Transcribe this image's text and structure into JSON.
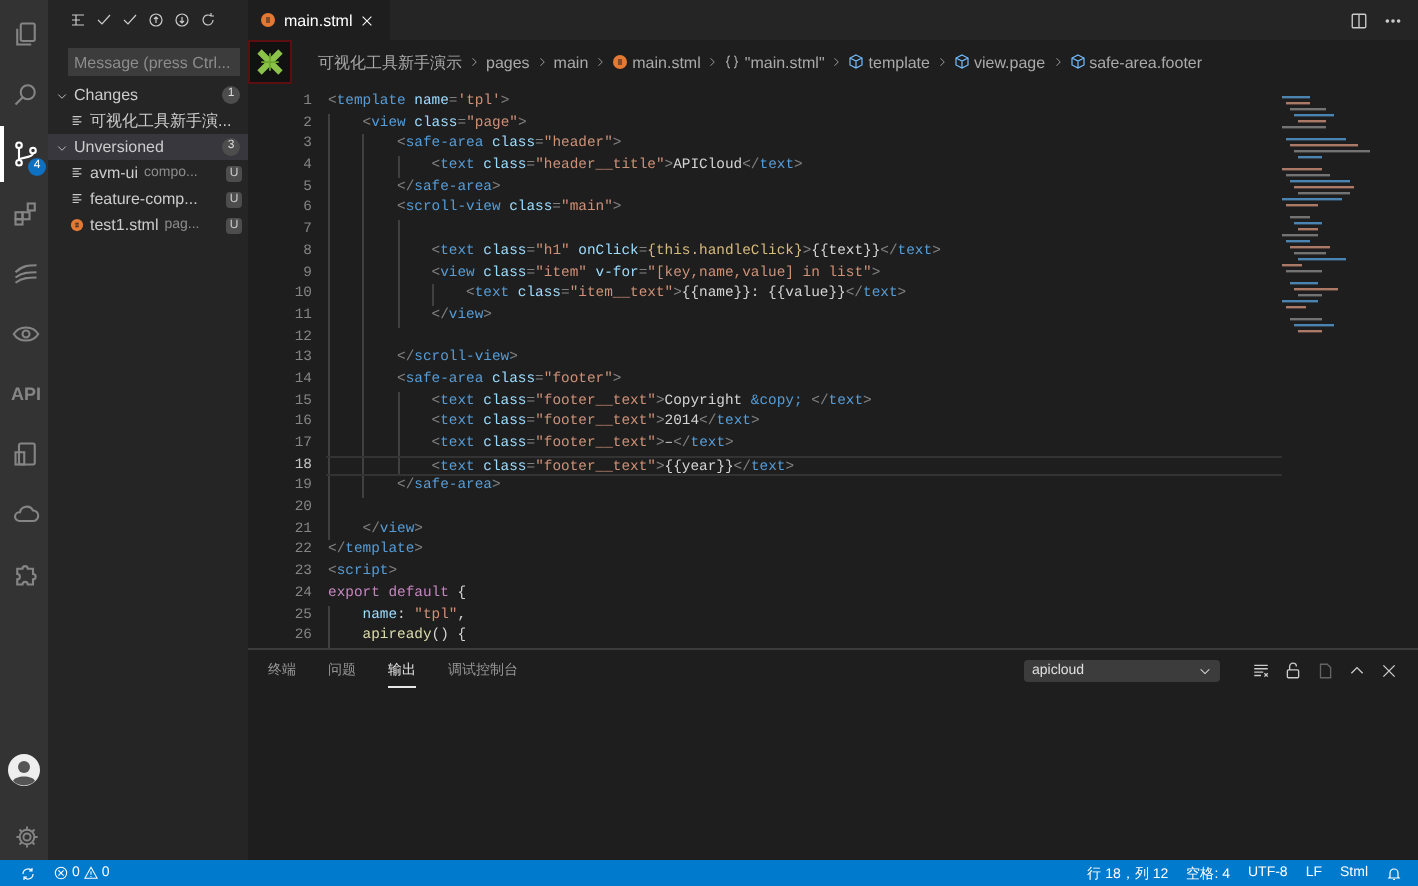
{
  "activity_bar": [
    {
      "kind": "files",
      "selected": false
    },
    {
      "kind": "search",
      "selected": false
    },
    {
      "kind": "scm",
      "selected": true,
      "badge": "4"
    },
    {
      "kind": "extensions",
      "selected": false
    },
    {
      "kind": "swirl",
      "selected": false
    },
    {
      "kind": "eye",
      "selected": false
    },
    {
      "kind": "api",
      "label": "API",
      "selected": false
    },
    {
      "kind": "phone",
      "selected": false
    },
    {
      "kind": "cloud",
      "selected": false
    },
    {
      "kind": "puzzle",
      "selected": false
    }
  ],
  "sidebar": {
    "message_field": {
      "placeholder": "Message (press Ctrl..."
    },
    "groups": [
      {
        "label": "Changes",
        "count": "1",
        "expanded": true,
        "items": [
          {
            "kind": "file",
            "name": "可视化工具新手演...",
            "selected": false
          }
        ]
      },
      {
        "label": "Unversioned",
        "count": "3",
        "expanded": true,
        "items": [
          {
            "kind": "file",
            "name": "avm-ui",
            "detail": "compo...",
            "badge": "U",
            "selected": false
          },
          {
            "kind": "file",
            "name": "feature-comp...",
            "badge": "U",
            "selected": false
          },
          {
            "kind": "stml",
            "name": "test1.stml",
            "detail": "pag...",
            "badge": "U",
            "selected": false
          }
        ]
      }
    ]
  },
  "tabs": [
    {
      "label": "main.stml",
      "selected": true
    }
  ],
  "breadcrumbs": [
    {
      "kind": "folder",
      "label": "可视化工具新手演示"
    },
    {
      "kind": "folder",
      "label": "pages"
    },
    {
      "kind": "folder",
      "label": "main"
    },
    {
      "kind": "stml",
      "label": "main.stml"
    },
    {
      "kind": "module",
      "label": "\"main.stml\""
    },
    {
      "kind": "element",
      "label": "template"
    },
    {
      "kind": "element",
      "label": "view.page"
    },
    {
      "kind": "element",
      "label": "safe-area.footer"
    }
  ],
  "code": [
    {
      "number": "1",
      "current": false,
      "tokens": [
        {
          "kind": "punct",
          "text": "<"
        },
        {
          "kind": "tag",
          "text": "template"
        },
        {
          "kind": "attr",
          "text": " name"
        },
        {
          "kind": "punct",
          "text": "="
        },
        {
          "kind": "string",
          "text": "'tpl'"
        },
        {
          "kind": "punct",
          "text": ">"
        }
      ]
    },
    {
      "number": "2",
      "current": false,
      "tokens": [
        {
          "kind": "punct",
          "text": "    <"
        },
        {
          "kind": "tag",
          "text": "view"
        },
        {
          "kind": "attr",
          "text": " class"
        },
        {
          "kind": "punct",
          "text": "="
        },
        {
          "kind": "string",
          "text": "\"page\""
        },
        {
          "kind": "punct",
          "text": ">"
        }
      ]
    },
    {
      "number": "3",
      "current": false,
      "tokens": [
        {
          "kind": "punct",
          "text": "        <"
        },
        {
          "kind": "tag",
          "text": "safe-area"
        },
        {
          "kind": "attr",
          "text": " class"
        },
        {
          "kind": "punct",
          "text": "="
        },
        {
          "kind": "string",
          "text": "\"header\""
        },
        {
          "kind": "punct",
          "text": ">"
        }
      ]
    },
    {
      "number": "4",
      "current": false,
      "tokens": [
        {
          "kind": "punct",
          "text": "            <"
        },
        {
          "kind": "tag",
          "text": "text"
        },
        {
          "kind": "attr",
          "text": " class"
        },
        {
          "kind": "punct",
          "text": "="
        },
        {
          "kind": "string",
          "text": "\"header__title\""
        },
        {
          "kind": "punct",
          "text": ">"
        },
        {
          "kind": "text",
          "text": "APICloud"
        },
        {
          "kind": "punct",
          "text": "</"
        },
        {
          "kind": "tag",
          "text": "text"
        },
        {
          "kind": "punct",
          "text": ">"
        }
      ]
    },
    {
      "number": "5",
      "current": false,
      "tokens": [
        {
          "kind": "punct",
          "text": "        </"
        },
        {
          "kind": "tag",
          "text": "safe-area"
        },
        {
          "kind": "punct",
          "text": ">"
        }
      ]
    },
    {
      "number": "6",
      "current": false,
      "tokens": [
        {
          "kind": "punct",
          "text": "        <"
        },
        {
          "kind": "tag",
          "text": "scroll-view"
        },
        {
          "kind": "attr",
          "text": " class"
        },
        {
          "kind": "punct",
          "text": "="
        },
        {
          "kind": "string",
          "text": "\"main\""
        },
        {
          "kind": "punct",
          "text": ">"
        }
      ]
    },
    {
      "number": "7",
      "current": false
    },
    {
      "number": "8",
      "current": false,
      "tokens": [
        {
          "kind": "punct",
          "text": "            <"
        },
        {
          "kind": "tag",
          "text": "text"
        },
        {
          "kind": "attr",
          "text": " class"
        },
        {
          "kind": "punct",
          "text": "="
        },
        {
          "kind": "string",
          "text": "\"h1\""
        },
        {
          "kind": "attr",
          "text": " onClick"
        },
        {
          "kind": "punct",
          "text": "="
        },
        {
          "kind": "expr",
          "text": "{this.handleClick}"
        },
        {
          "kind": "punct",
          "text": ">"
        },
        {
          "kind": "text",
          "text": "{{text}}"
        },
        {
          "kind": "punct",
          "text": "</"
        },
        {
          "kind": "tag",
          "text": "text"
        },
        {
          "kind": "punct",
          "text": ">"
        }
      ]
    },
    {
      "number": "9",
      "current": false,
      "tokens": [
        {
          "kind": "punct",
          "text": "            <"
        },
        {
          "kind": "tag",
          "text": "view"
        },
        {
          "kind": "attr",
          "text": " class"
        },
        {
          "kind": "punct",
          "text": "="
        },
        {
          "kind": "string",
          "text": "\"item\""
        },
        {
          "kind": "attr",
          "text": " v-for"
        },
        {
          "kind": "punct",
          "text": "="
        },
        {
          "kind": "string",
          "text": "\"[key,name,value] in list\""
        },
        {
          "kind": "punct",
          "text": ">"
        }
      ]
    },
    {
      "number": "10",
      "current": false,
      "tokens": [
        {
          "kind": "punct",
          "text": "                <"
        },
        {
          "kind": "tag",
          "text": "text"
        },
        {
          "kind": "attr",
          "text": " class"
        },
        {
          "kind": "punct",
          "text": "="
        },
        {
          "kind": "string",
          "text": "\"item__text\""
        },
        {
          "kind": "punct",
          "text": ">"
        },
        {
          "kind": "text",
          "text": "{{name}}: {{value}}"
        },
        {
          "kind": "punct",
          "text": "</"
        },
        {
          "kind": "tag",
          "text": "text"
        },
        {
          "kind": "punct",
          "text": ">"
        }
      ]
    },
    {
      "number": "11",
      "current": false,
      "tokens": [
        {
          "kind": "punct",
          "text": "            </"
        },
        {
          "kind": "tag",
          "text": "view"
        },
        {
          "kind": "punct",
          "text": ">"
        }
      ]
    },
    {
      "number": "12",
      "current": false
    },
    {
      "number": "13",
      "current": false,
      "tokens": [
        {
          "kind": "punct",
          "text": "        </"
        },
        {
          "kind": "tag",
          "text": "scroll-view"
        },
        {
          "kind": "punct",
          "text": ">"
        }
      ]
    },
    {
      "number": "14",
      "current": false,
      "tokens": [
        {
          "kind": "punct",
          "text": "        <"
        },
        {
          "kind": "tag",
          "text": "safe-area"
        },
        {
          "kind": "attr",
          "text": " class"
        },
        {
          "kind": "punct",
          "text": "="
        },
        {
          "kind": "string",
          "text": "\"footer\""
        },
        {
          "kind": "punct",
          "text": ">"
        }
      ]
    },
    {
      "number": "15",
      "current": false,
      "tokens": [
        {
          "kind": "punct",
          "text": "            <"
        },
        {
          "kind": "tag",
          "text": "text"
        },
        {
          "kind": "attr",
          "text": " class"
        },
        {
          "kind": "punct",
          "text": "="
        },
        {
          "kind": "string",
          "text": "\"footer__text\""
        },
        {
          "kind": "punct",
          "text": ">"
        },
        {
          "kind": "text",
          "text": "Copyright "
        },
        {
          "kind": "tag",
          "text": "&copy;"
        },
        {
          "kind": "punct",
          "text": " </"
        },
        {
          "kind": "tag",
          "text": "text"
        },
        {
          "kind": "punct",
          "text": ">"
        }
      ]
    },
    {
      "number": "16",
      "current": false,
      "tokens": [
        {
          "kind": "punct",
          "text": "            <"
        },
        {
          "kind": "tag",
          "text": "text"
        },
        {
          "kind": "attr",
          "text": " class"
        },
        {
          "kind": "punct",
          "text": "="
        },
        {
          "kind": "string",
          "text": "\"footer__text\""
        },
        {
          "kind": "punct",
          "text": ">"
        },
        {
          "kind": "text",
          "text": "2014"
        },
        {
          "kind": "punct",
          "text": "</"
        },
        {
          "kind": "tag",
          "text": "text"
        },
        {
          "kind": "punct",
          "text": ">"
        }
      ]
    },
    {
      "number": "17",
      "current": false,
      "tokens": [
        {
          "kind": "punct",
          "text": "            <"
        },
        {
          "kind": "tag",
          "text": "text"
        },
        {
          "kind": "attr",
          "text": " class"
        },
        {
          "kind": "punct",
          "text": "="
        },
        {
          "kind": "string",
          "text": "\"footer__text\""
        },
        {
          "kind": "punct",
          "text": ">"
        },
        {
          "kind": "text",
          "text": "–"
        },
        {
          "kind": "punct",
          "text": "</"
        },
        {
          "kind": "tag",
          "text": "text"
        },
        {
          "kind": "punct",
          "text": ">"
        }
      ]
    },
    {
      "number": "18",
      "current": true,
      "tokens": [
        {
          "kind": "punct",
          "text": "            <"
        },
        {
          "kind": "tag",
          "text": "text"
        },
        {
          "kind": "attr",
          "text": " class"
        },
        {
          "kind": "punct",
          "text": "="
        },
        {
          "kind": "string",
          "text": "\"footer__text\""
        },
        {
          "kind": "punct",
          "text": ">"
        },
        {
          "kind": "text",
          "text": "{{year}}"
        },
        {
          "kind": "punct",
          "text": "</"
        },
        {
          "kind": "tag",
          "text": "text"
        },
        {
          "kind": "punct",
          "text": ">"
        }
      ]
    },
    {
      "number": "19",
      "current": false,
      "tokens": [
        {
          "kind": "punct",
          "text": "        </"
        },
        {
          "kind": "tag",
          "text": "safe-area"
        },
        {
          "kind": "punct",
          "text": ">"
        }
      ]
    },
    {
      "number": "20",
      "current": false
    },
    {
      "number": "21",
      "current": false,
      "tokens": [
        {
          "kind": "punct",
          "text": "    </"
        },
        {
          "kind": "tag",
          "text": "view"
        },
        {
          "kind": "punct",
          "text": ">"
        }
      ]
    },
    {
      "number": "22",
      "current": false,
      "tokens": [
        {
          "kind": "punct",
          "text": "</"
        },
        {
          "kind": "tag",
          "text": "template"
        },
        {
          "kind": "punct",
          "text": ">"
        }
      ]
    },
    {
      "number": "23",
      "current": false,
      "tokens": [
        {
          "kind": "punct",
          "text": "<"
        },
        {
          "kind": "tag",
          "text": "script"
        },
        {
          "kind": "punct",
          "text": ">"
        }
      ]
    },
    {
      "number": "24",
      "current": false,
      "tokens": [
        {
          "kind": "keyword",
          "text": "export default"
        },
        {
          "kind": "text",
          "text": " {"
        }
      ]
    },
    {
      "number": "25",
      "current": false,
      "tokens": [
        {
          "kind": "attr",
          "text": "    name"
        },
        {
          "kind": "text",
          "text": ": "
        },
        {
          "kind": "string",
          "text": "\"tpl\""
        },
        {
          "kind": "text",
          "text": ","
        }
      ]
    },
    {
      "number": "26",
      "current": false,
      "tokens": [
        {
          "kind": "func",
          "text": "    apiready"
        },
        {
          "kind": "text",
          "text": "() {"
        }
      ]
    }
  ],
  "panel": {
    "tabs": [
      {
        "label": "终端",
        "selected": false
      },
      {
        "label": "问题",
        "selected": false
      },
      {
        "label": "输出",
        "selected": true
      },
      {
        "label": "调试控制台",
        "selected": false
      }
    ],
    "channel": "apicloud"
  },
  "status_bar": {
    "errors": "0",
    "warnings": "0",
    "items": [
      "行 18，列 12",
      "空格: 4",
      "UTF-8",
      "LF",
      "Stml"
    ]
  }
}
